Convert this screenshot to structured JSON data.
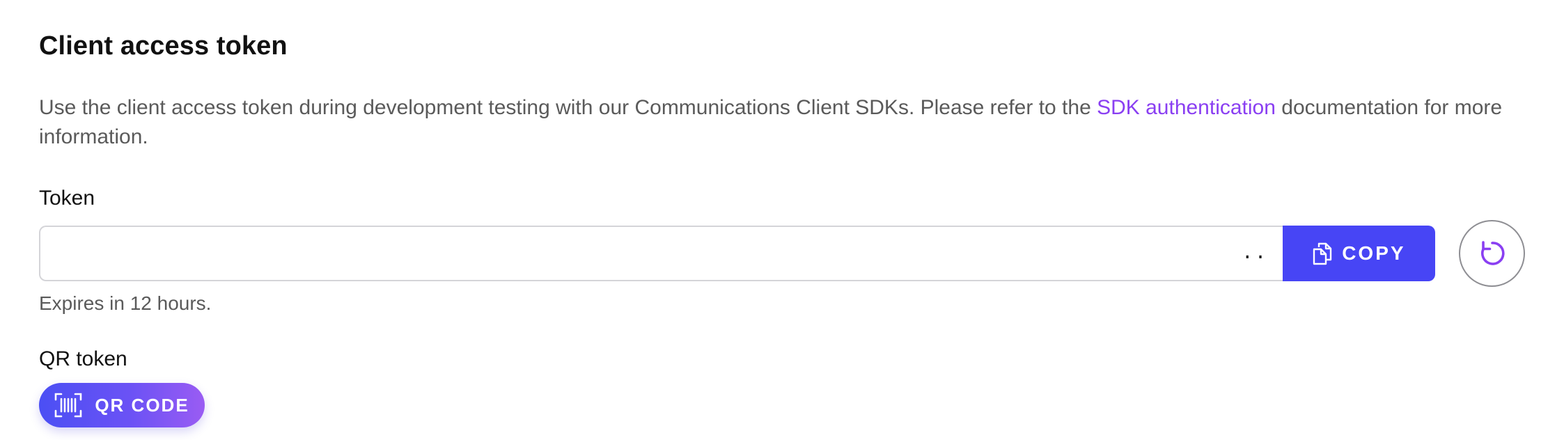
{
  "section": {
    "title": "Client access token",
    "description_before_link": "Use the client access token during development testing with our Communications Client SDKs. Please refer to the ",
    "description_link": "SDK authentication",
    "description_after_link": " documentation for more information."
  },
  "token": {
    "label": "Token",
    "value": "..",
    "copy_label": "COPY",
    "copy_icon": "copy-icon",
    "refresh_icon": "refresh-icon",
    "expiry_text": "Expires in 12 hours."
  },
  "qr": {
    "label": "QR token",
    "button_label": "QR CODE",
    "button_icon": "qr-scan-icon"
  },
  "colors": {
    "primary": "#4745f5",
    "link": "#8a3ff2",
    "refresh_icon": "#8a3ff2",
    "qr_gradient_start": "#4b4ff4",
    "qr_gradient_end": "#9a5cf3"
  }
}
